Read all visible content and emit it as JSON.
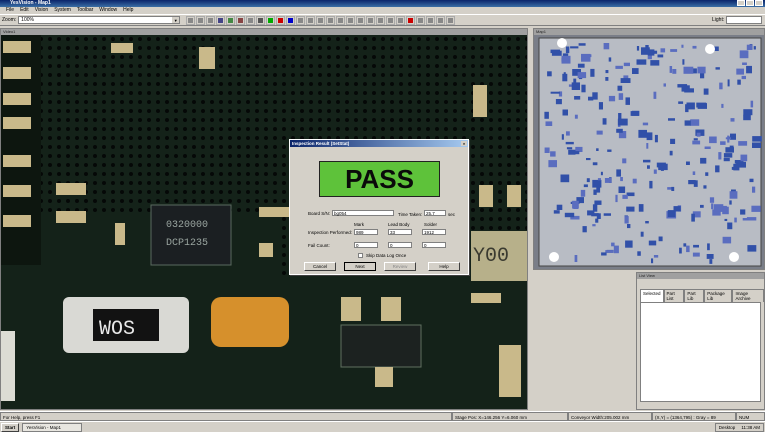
{
  "window": {
    "title": "YesVision - Map1"
  },
  "menu": [
    "File",
    "Edit",
    "Vision",
    "System",
    "Toolbar",
    "Window",
    "Help"
  ],
  "toolbar": {
    "zoom_label": "Zoom:",
    "zoom_value": "100%",
    "light_label": "Light:"
  },
  "main_view": {
    "title": "Video1"
  },
  "map_view": {
    "title": "Map1"
  },
  "list_view": {
    "title": "List View",
    "tabs": [
      "Selected",
      "Part List",
      "Part Lib",
      "Package Lib",
      "Image Archive"
    ]
  },
  "dialog": {
    "title": "Inspection Result (SetStat)",
    "result": "PASS",
    "board_sn_label": "Board S/N:",
    "board_sn_value": "bg054",
    "time_taken_label": "Time Taken:",
    "time_taken_value": "25.7",
    "time_unit": "sec",
    "col_mark": "Mark",
    "col_lead_body": "Lead Body",
    "col_solder": "Solder",
    "inspection_label": "Inspection Performed:",
    "insp_mark": "989",
    "insp_lead": "33",
    "insp_solder": "1912",
    "fail_label": "Fail Count:",
    "fail_mark": "0",
    "fail_lead": "0",
    "fail_solder": "0",
    "skip_label": "Skip Data Log Once",
    "btn_cancel": "Cancel",
    "btn_next": "Next",
    "btn_review": "Review",
    "btn_help": "Help"
  },
  "status": {
    "help": "For Help, press F1",
    "stage_pos": "Stage Pos: X=146.256 Y=6.060 mm",
    "conveyor": "Conveyor Width:205.002 mm",
    "coords": "(X,Y) = (1364,795) : Gray = 89",
    "mode": "NUM"
  },
  "taskbar": {
    "start": "Start",
    "app": "YesVision - Map1",
    "desktop": "Desktop",
    "clock": "11:38 AM"
  },
  "colors": {
    "pass_green": "#5ec23a",
    "titlebar": "#0a246a"
  }
}
